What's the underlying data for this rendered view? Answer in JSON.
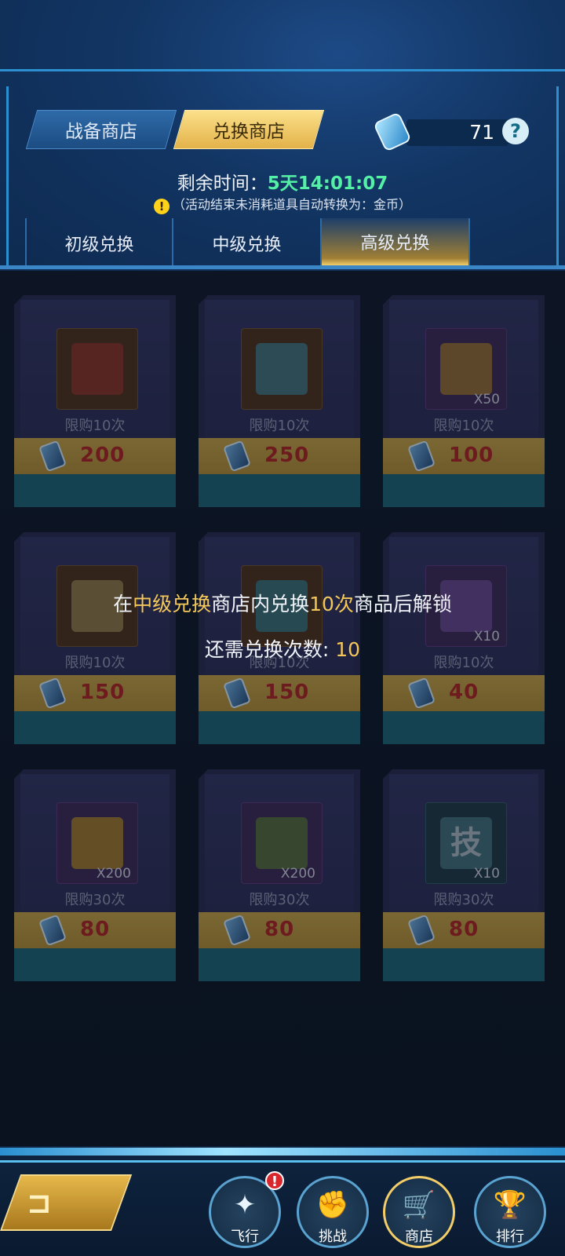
{
  "header": {
    "shop_tabs": [
      {
        "label": "战备商店",
        "active": false
      },
      {
        "label": "兑换商店",
        "active": true
      }
    ],
    "currency": {
      "icon": "exchange-ticket-icon",
      "value": "71",
      "help_icon": "help-icon"
    }
  },
  "timer": {
    "label": "剩余时间：",
    "value": "5天14:01:07"
  },
  "notice": {
    "icon": "warning-icon",
    "text": "（活动结束未消耗道具自动转换为：金币）"
  },
  "tier_tabs": [
    {
      "label": "初级兑换",
      "active": false
    },
    {
      "label": "中级兑换",
      "active": false
    },
    {
      "label": "高级兑换",
      "active": true
    }
  ],
  "items": [
    {
      "name": "missile-part",
      "qty": "",
      "limit": "限购10次",
      "price": "200",
      "slot": "orange",
      "color": "#a2352c"
    },
    {
      "name": "energy-capsule",
      "qty": "",
      "limit": "限购10次",
      "price": "250",
      "slot": "orange",
      "color": "#3d8fa8"
    },
    {
      "name": "gold-chest",
      "qty": "X50",
      "limit": "限购10次",
      "price": "100",
      "slot": "purple",
      "color": "#b78a2a"
    },
    {
      "name": "circuit-chip",
      "qty": "",
      "limit": "限购10次",
      "price": "150",
      "slot": "orange",
      "color": "#a89a5a"
    },
    {
      "name": "teal-engine",
      "qty": "",
      "limit": "限购10次",
      "price": "150",
      "slot": "orange",
      "color": "#2f8aa2"
    },
    {
      "name": "skin-scroll",
      "qty": "X10",
      "limit": "限购10次",
      "price": "40",
      "slot": "purple",
      "color": "#7a55a8"
    },
    {
      "name": "gold-cube",
      "qty": "X200",
      "limit": "限购30次",
      "price": "80",
      "slot": "purple",
      "color": "#c89a1e"
    },
    {
      "name": "green-cube",
      "qty": "X200",
      "limit": "限购30次",
      "price": "80",
      "slot": "purple",
      "color": "#5f8a32"
    },
    {
      "name": "skill-cube",
      "qty": "X10",
      "limit": "限购30次",
      "price": "80",
      "slot": "teal",
      "color": "#4f8892",
      "glyph": "技"
    }
  ],
  "lock_message": {
    "prefix": "在",
    "highlight1": "中级兑换",
    "middle": "商店内兑换",
    "highlight2": "10次",
    "suffix": "商品后解锁",
    "remaining_label": "还需兑换次数: ",
    "remaining_value": "10"
  },
  "bottom_nav": {
    "back_icon": "back-icon",
    "items": [
      {
        "label": "飞行",
        "icon": "fly-icon",
        "glyph": "✦",
        "badge": "!"
      },
      {
        "label": "挑战",
        "icon": "fist-icon",
        "glyph": "✊"
      },
      {
        "label": "商店",
        "icon": "cart-icon",
        "glyph": "🛒",
        "active": true
      },
      {
        "label": "排行",
        "icon": "trophy-icon",
        "glyph": "🏆"
      }
    ]
  }
}
